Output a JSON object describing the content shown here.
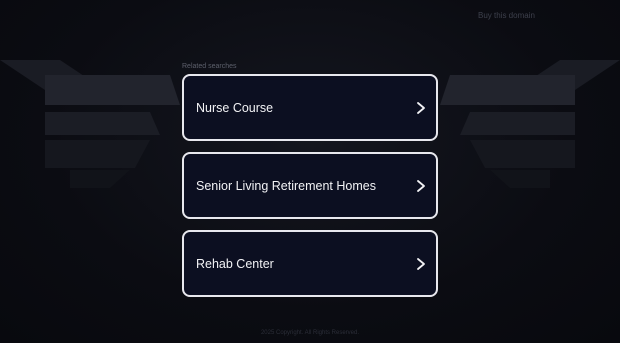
{
  "header": {
    "buy_link_label": "Buy this domain"
  },
  "related": {
    "label": "Related searches",
    "items": [
      {
        "label": "Nurse Course"
      },
      {
        "label": "Senior Living Retirement Homes"
      },
      {
        "label": "Rehab Center"
      }
    ]
  },
  "footer": {
    "copyright": "2025 Copyright. All Rights Reserved."
  },
  "colors": {
    "background": "#0b0c12",
    "card_background": "#0c0f21",
    "card_border": "#e8e8ee",
    "text": "#f2f2f5"
  },
  "icons": {
    "result_chevron": "chevron-right-icon"
  }
}
